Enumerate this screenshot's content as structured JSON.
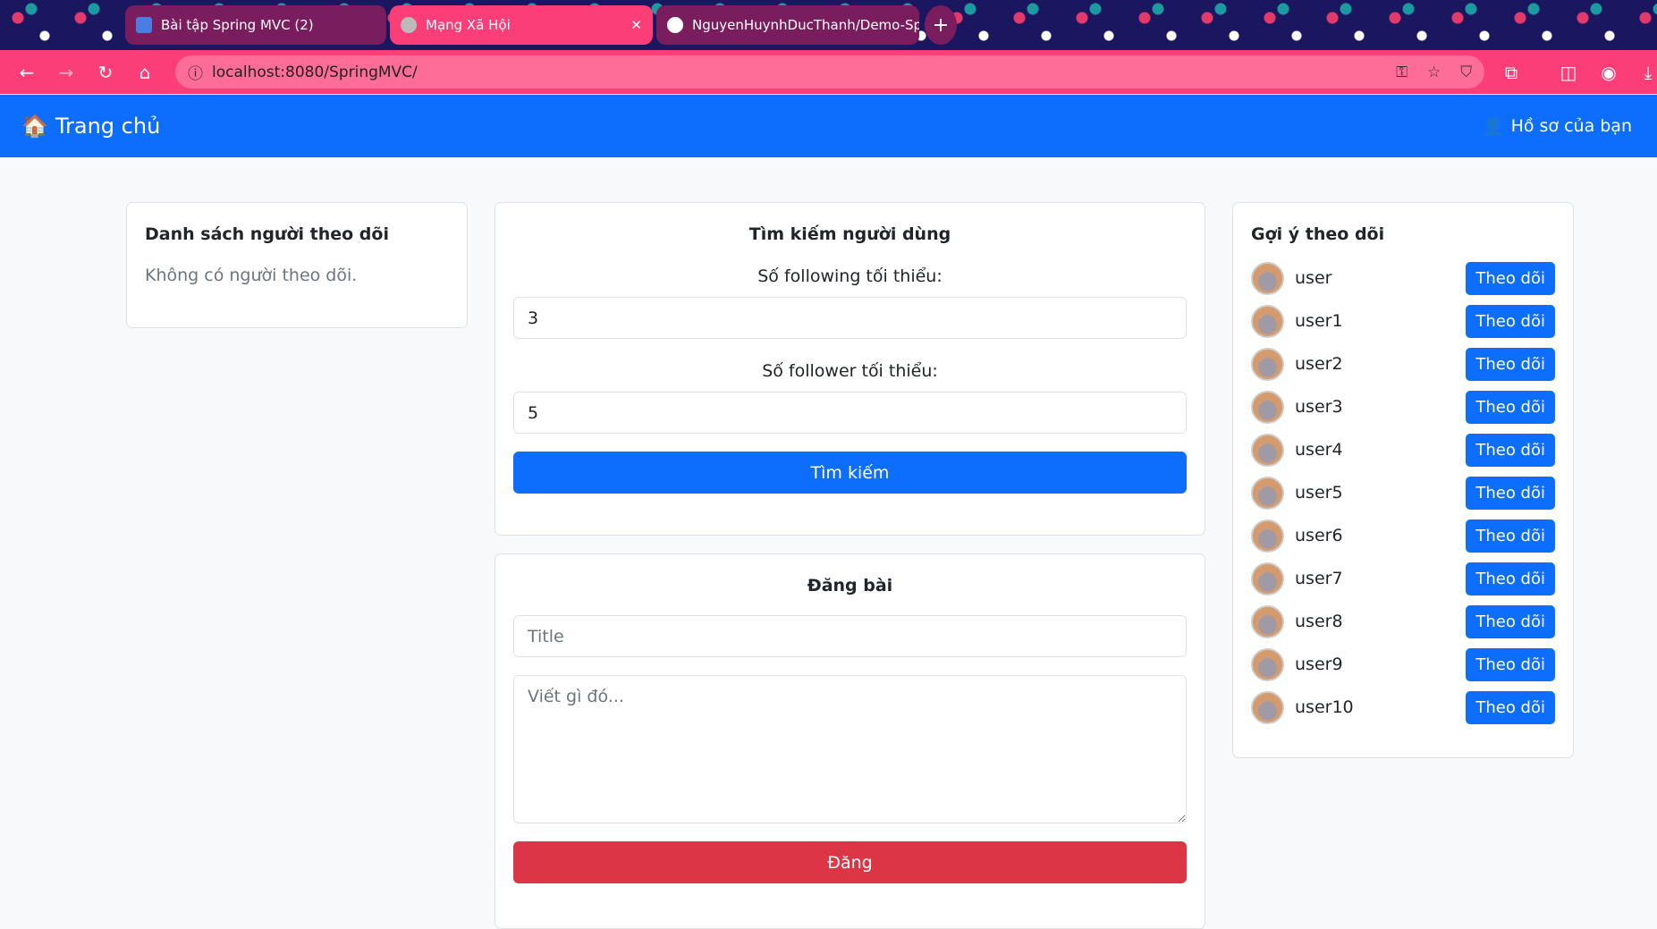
{
  "browser": {
    "tabs": [
      {
        "label": "Bài tập Spring MVC (2)",
        "active": false
      },
      {
        "label": "Mạng Xã Hội",
        "active": true
      },
      {
        "label": "NguyenHuynhDucThanh/Demo-Sp",
        "active": false
      }
    ],
    "url": "localhost:8080/SpringMVC/"
  },
  "navbar": {
    "brand": "Trang chủ",
    "profile": "Hồ sơ của bạn"
  },
  "followers": {
    "title": "Danh sách người theo dõi",
    "empty": "Không có người theo dõi."
  },
  "search": {
    "title": "Tìm kiếm người dùng",
    "following_label": "Số following tối thiểu:",
    "following_value": "3",
    "follower_label": "Số follower tối thiểu:",
    "follower_value": "5",
    "button": "Tìm kiếm"
  },
  "post": {
    "title": "Đăng bài",
    "title_placeholder": "Title",
    "content_placeholder": "Viết gì đó...",
    "button": "Đăng"
  },
  "suggestions": {
    "title": "Gợi ý theo dõi",
    "follow_label": "Theo dõi",
    "users": [
      "user",
      "user1",
      "user2",
      "user3",
      "user4",
      "user5",
      "user6",
      "user7",
      "user8",
      "user9",
      "user10"
    ]
  },
  "colors": {
    "primary": "#0d6efd",
    "danger": "#dc3545",
    "browser_accent": "#fb3d78"
  }
}
